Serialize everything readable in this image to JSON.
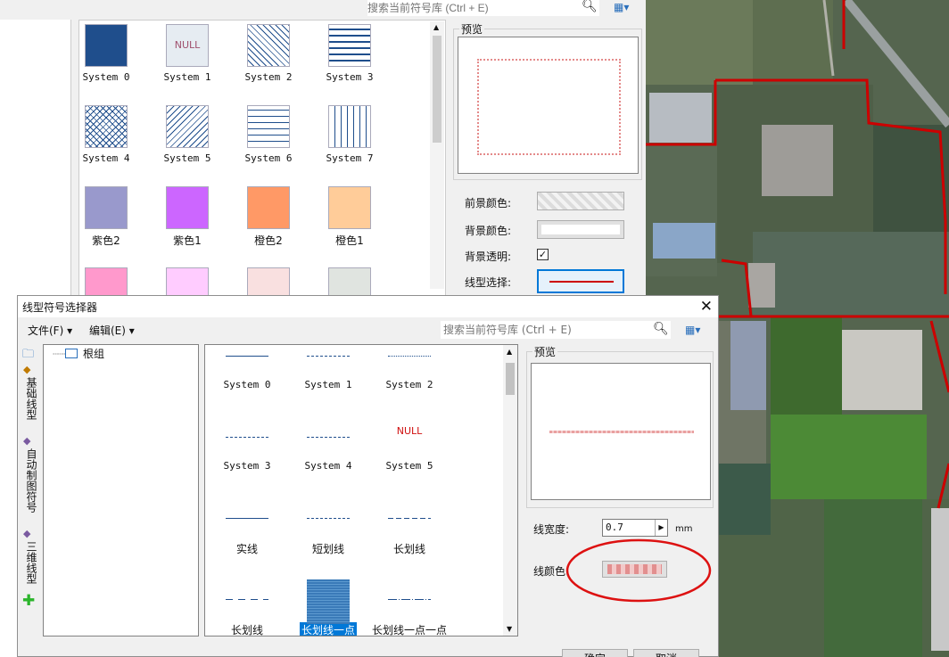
{
  "fill_dialog": {
    "search_placeholder": "搜索当前符号库 (Ctrl + E)",
    "symbols": [
      {
        "label": "System 0",
        "style": "solid-blue"
      },
      {
        "label": "System 1",
        "style": "null"
      },
      {
        "label": "System 2",
        "style": "diag"
      },
      {
        "label": "System 3",
        "style": "grid"
      },
      {
        "label": "System 4",
        "style": "cross"
      },
      {
        "label": "System 5",
        "style": "diag2"
      },
      {
        "label": "System 6",
        "style": "horiz"
      },
      {
        "label": "System 7",
        "style": "vert"
      },
      {
        "label": "紫色2",
        "color": "#9999cc"
      },
      {
        "label": "紫色1",
        "color": "#cc66ff"
      },
      {
        "label": "橙色2",
        "color": "#ff9966"
      },
      {
        "label": "橙色1",
        "color": "#ffcc99"
      },
      {
        "label": "",
        "color": "#ff99cc"
      },
      {
        "label": "",
        "color": "#ffccff"
      },
      {
        "label": "",
        "color": "#f9e0e0"
      },
      {
        "label": "",
        "color": "#e0e4e0"
      }
    ],
    "null_text": "NULL",
    "preview_title": "预览",
    "fg_color_label": "前景颜色:",
    "bg_color_label": "背景颜色:",
    "bg_transparent_label": "背景透明:",
    "line_select_label": "线型选择:"
  },
  "line_dialog": {
    "title": "线型符号选择器",
    "menu": {
      "file": "文件(F)",
      "edit": "编辑(E)"
    },
    "search_placeholder": "搜索当前符号库 (Ctrl + E)",
    "side_tabs": [
      "基础线型",
      "自动制图符号",
      "三维线型"
    ],
    "tree_root": "根组",
    "symbols": [
      {
        "label": "System 0",
        "kind": "solid-thin"
      },
      {
        "label": "System 1",
        "kind": "dashed-fine"
      },
      {
        "label": "System 2",
        "kind": "dotted-fine"
      },
      {
        "label": "System 3",
        "kind": "dashed-fine"
      },
      {
        "label": "System 4",
        "kind": "dashed-fine"
      },
      {
        "label": "System 5",
        "kind": "null"
      },
      {
        "label": "实线",
        "kind": "solid"
      },
      {
        "label": "短划线",
        "kind": "short-dash"
      },
      {
        "label": "长划线",
        "kind": "long-dash"
      },
      {
        "label": "长划线",
        "kind": "long-dash2"
      },
      {
        "label": "长划线一点",
        "kind": "selected"
      },
      {
        "label": "长划线一点一点",
        "kind": "dash-dot-dot"
      }
    ],
    "null_text": "NULL",
    "preview_title": "预览",
    "width_label": "线宽度:",
    "width_value": "0.7",
    "width_unit": "mm",
    "color_label": "线颜色:",
    "ok_label": "确定",
    "cancel_label": "取消"
  },
  "colors": {
    "accent": "#0078d7",
    "map_boundary": "#cc0000",
    "symbol_blue": "#1f4e8c"
  }
}
